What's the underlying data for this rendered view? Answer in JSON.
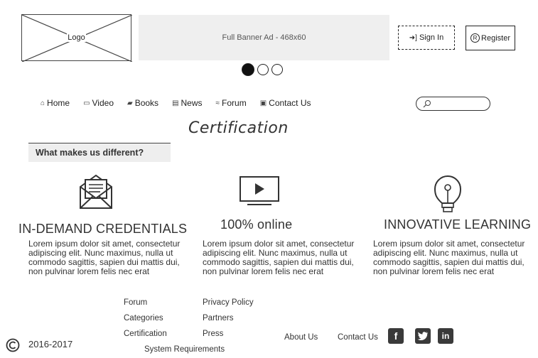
{
  "header": {
    "logo_label": "Logo",
    "banner_label": "Full Banner Ad - 468x60",
    "sign_in_label": "Sign In",
    "register_label": "Register"
  },
  "carousel": {
    "active_index": 0,
    "count": 3
  },
  "nav": {
    "items": [
      {
        "label": "Home",
        "icon": "home-icon"
      },
      {
        "label": "Video",
        "icon": "video-icon"
      },
      {
        "label": "Books",
        "icon": "book-icon"
      },
      {
        "label": "News",
        "icon": "newspaper-icon"
      },
      {
        "label": "Forum",
        "icon": "forum-icon"
      },
      {
        "label": "Contact Us",
        "icon": "contact-card-icon"
      }
    ],
    "search_placeholder": ""
  },
  "main": {
    "title": "Certification",
    "subtitle": "What makes us different?",
    "features": [
      {
        "icon": "envelope-certificate-icon",
        "title": "IN-DEMAND CREDENTIALS",
        "text": "Lorem ipsum dolor sit amet, consectetur adipiscing elit. Nunc maximus, nulla ut commodo sagittis, sapien dui mattis dui, non pulvinar lorem felis nec erat"
      },
      {
        "icon": "play-screen-icon",
        "title": "100% online",
        "text": "Lorem ipsum dolor sit amet, consectetur adipiscing elit. Nunc maximus, nulla ut commodo sagittis, sapien dui mattis dui, non pulvinar lorem felis nec erat"
      },
      {
        "icon": "lightbulb-icon",
        "title": "INNOVATIVE LEARNING",
        "text": "Lorem ipsum dolor sit amet, consectetur adipiscing elit. Nunc maximus, nulla ut commodo sagittis, sapien dui mattis dui, non pulvinar lorem felis nec erat"
      }
    ]
  },
  "footer": {
    "col1": [
      "Forum",
      "Categories",
      "Certification"
    ],
    "col2": [
      "Privacy Policy",
      "Partners",
      "Press"
    ],
    "system_requirements": "System Requirements",
    "about_us": "About Us",
    "contact_us": "Contact Us",
    "year": "2016-2017",
    "social": [
      "facebook-icon",
      "twitter-icon",
      "linkedin-icon"
    ]
  }
}
